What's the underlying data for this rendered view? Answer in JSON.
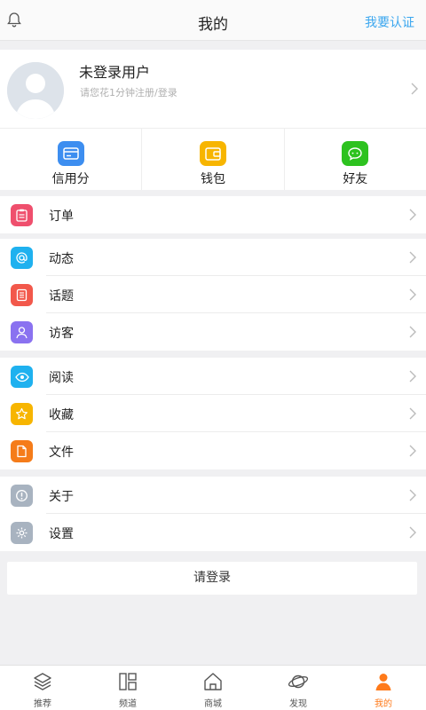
{
  "header": {
    "title": "我的",
    "auth_link": "我要认证",
    "accent_color": "#3aa6ef"
  },
  "profile": {
    "name": "未登录用户",
    "hint": "请您花1分钟注册/登录"
  },
  "quick_actions": [
    {
      "label": "信用分",
      "icon": "credit-card-icon",
      "color": "#3d8ef0"
    },
    {
      "label": "钱包",
      "icon": "wallet-icon",
      "color": "#f7b500"
    },
    {
      "label": "好友",
      "icon": "chat-icon",
      "color": "#2dc21f"
    }
  ],
  "menu": {
    "orders": {
      "label": "订单",
      "icon": "clipboard-icon",
      "color": "#ef4f6d"
    },
    "feed": {
      "label": "动态",
      "icon": "at-icon",
      "color": "#1fb1ef"
    },
    "topics": {
      "label": "话题",
      "icon": "document-icon",
      "color": "#f2584b"
    },
    "visitors": {
      "label": "访客",
      "icon": "person-icon",
      "color": "#8a72f0"
    },
    "reading": {
      "label": "阅读",
      "icon": "eye-icon",
      "color": "#1fb1ef"
    },
    "favorites": {
      "label": "收藏",
      "icon": "star-icon",
      "color": "#f7b500"
    },
    "files": {
      "label": "文件",
      "icon": "file-icon",
      "color": "#f57c1a"
    },
    "about": {
      "label": "关于",
      "icon": "info-icon",
      "color": "#a8b3c0"
    },
    "settings": {
      "label": "设置",
      "icon": "gear-icon",
      "color": "#a8b3c0"
    }
  },
  "login_button": "请登录",
  "tabs": [
    {
      "label": "推荐",
      "icon": "layers-icon"
    },
    {
      "label": "频道",
      "icon": "grid-icon"
    },
    {
      "label": "商城",
      "icon": "home-icon"
    },
    {
      "label": "发现",
      "icon": "planet-icon"
    },
    {
      "label": "我的",
      "icon": "person-icon",
      "active": true,
      "color": "#ff7a1a"
    }
  ]
}
